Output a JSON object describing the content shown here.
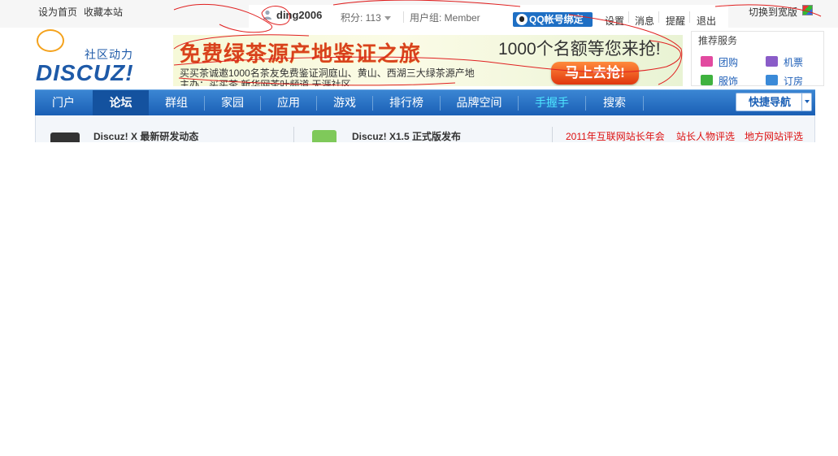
{
  "topbar": {
    "set_home": "设为首页",
    "bookmark": "收藏本站",
    "username": "ding2006",
    "credits": "积分: 113",
    "user_group": "用户组: Member",
    "qq_bind": "QQ帐号绑定",
    "links": [
      "设置",
      "消息",
      "提醒",
      "退出"
    ],
    "wide_switch": "切换到宽版"
  },
  "logo": {
    "subtitle": "社区动力",
    "name": "DISCUZ!"
  },
  "banner": {
    "title": "免费绿茶源产地鉴证之旅",
    "offer": "1000个名额等您来抢!",
    "line1": "买买茶诚邀1000名茶友免费鉴证洞庭山、黄山、西湖三大绿茶源产地",
    "line2": "主办：买买茶  新华网茶叶频道  天涯社区",
    "button": "马上去抢!"
  },
  "recommend": {
    "title": "推荐服务",
    "items": [
      {
        "label": "团购",
        "color": "#e24aa0"
      },
      {
        "label": "机票",
        "color": "#8a5cc8"
      },
      {
        "label": "服饰",
        "color": "#3fb23f"
      },
      {
        "label": "订房",
        "color": "#3a8ad8"
      }
    ]
  },
  "nav": {
    "items": [
      "门户",
      "论坛",
      "群组",
      "家园",
      "应用",
      "游戏",
      "排行榜",
      "品牌空间",
      "手握手",
      "搜索"
    ],
    "active": "论坛",
    "highlight": "手握手",
    "highlight_color": "#4ee6ff",
    "quick_nav": "快捷导航"
  },
  "news": {
    "items": [
      {
        "title": "Discuz! X 最新研发动态"
      },
      {
        "title": "Discuz! X1.5 正式版发布"
      }
    ],
    "hot_links": [
      "2011年互联网站长年会",
      "站长人物评选",
      "地方网站评选"
    ]
  }
}
